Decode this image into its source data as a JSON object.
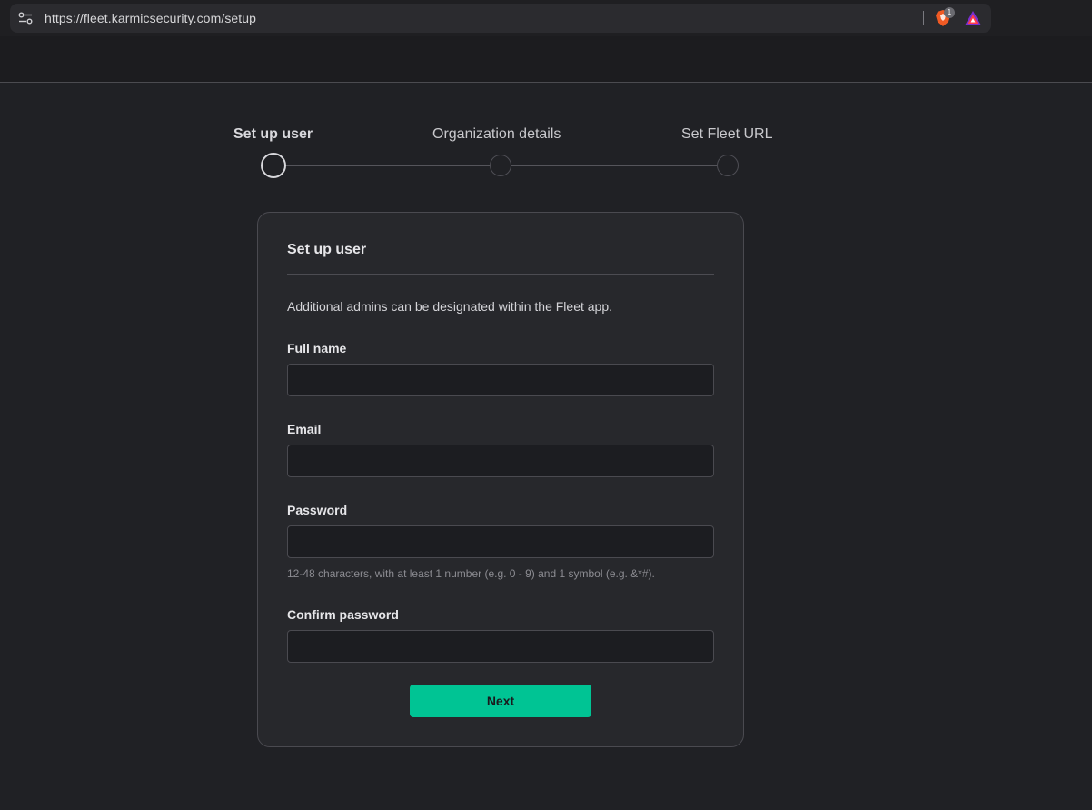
{
  "browser": {
    "url": "https://fleet.karmicsecurity.com/setup",
    "shield_count": "1",
    "icons": [
      "site-info-icon",
      "brave-shield-icon",
      "brave-rewards-icon"
    ]
  },
  "stepper": {
    "steps": [
      {
        "label": "Set up user",
        "active": true
      },
      {
        "label": "Organization details",
        "active": false
      },
      {
        "label": "Set Fleet URL",
        "active": false
      }
    ]
  },
  "form": {
    "title": "Set up user",
    "description": "Additional admins can be designated within the Fleet app.",
    "fields": [
      {
        "label": "Full name",
        "value": "",
        "placeholder": ""
      },
      {
        "label": "Email",
        "value": "",
        "placeholder": ""
      },
      {
        "label": "Password",
        "value": "",
        "placeholder": ""
      },
      {
        "label": "Confirm password",
        "value": "",
        "placeholder": ""
      }
    ],
    "password_help": "12-48 characters, with at least 1 number (e.g. 0 - 9) and 1 symbol (e.g. &*#).",
    "next_label": "Next"
  },
  "colors": {
    "accent": "#00c494",
    "background": "#202125",
    "card": "#27282c"
  }
}
